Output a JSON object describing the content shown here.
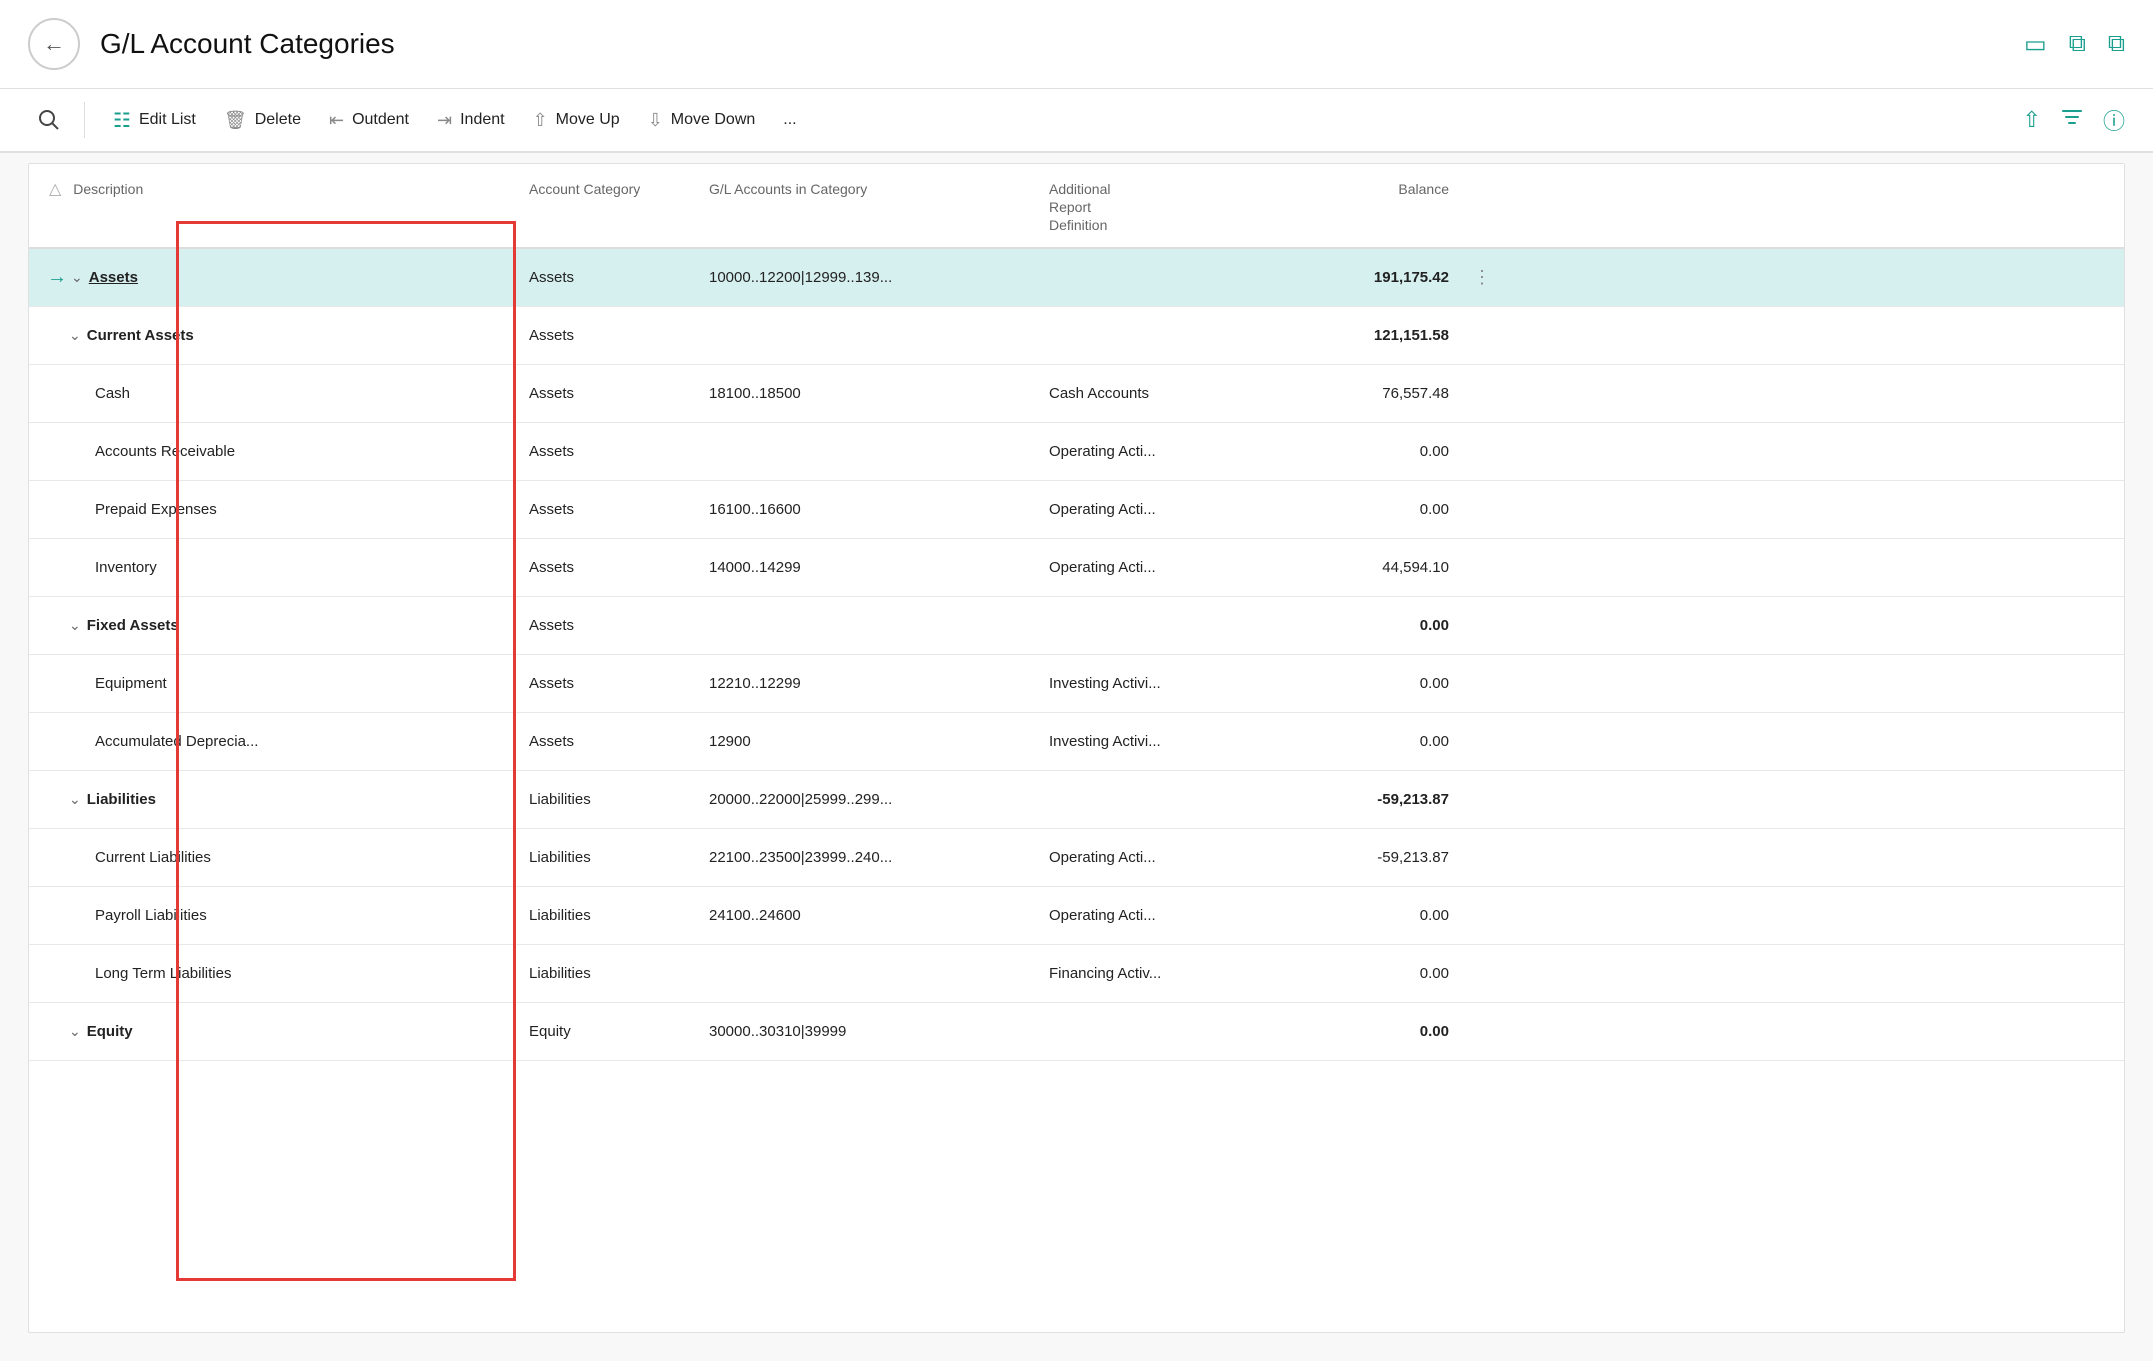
{
  "title": "G/L Account Categories",
  "toolbar": {
    "search_label": "Search",
    "edit_list_label": "Edit List",
    "delete_label": "Delete",
    "outdent_label": "Outdent",
    "indent_label": "Indent",
    "move_up_label": "Move Up",
    "move_down_label": "Move Down",
    "more_label": "..."
  },
  "columns": [
    {
      "id": "description",
      "label": "Description"
    },
    {
      "id": "account_category",
      "label": "Account Category"
    },
    {
      "id": "gl_accounts",
      "label": "G/L Accounts in Category"
    },
    {
      "id": "additional_report",
      "label": "Additional Report Definition"
    },
    {
      "id": "balance",
      "label": "Balance"
    }
  ],
  "rows": [
    {
      "id": "assets",
      "description": "Assets",
      "indent": 0,
      "bold": true,
      "underline": true,
      "chevron": "down",
      "selected": true,
      "arrow": true,
      "account_category": "Assets",
      "gl_accounts": "10000..12200|12999..139...",
      "additional_report": "",
      "balance": "191,175.42",
      "balance_bold": true,
      "dots": true
    },
    {
      "id": "current_assets",
      "description": "Current Assets",
      "indent": 1,
      "bold": true,
      "chevron": "down",
      "account_category": "Assets",
      "gl_accounts": "",
      "additional_report": "",
      "balance": "121,151.58",
      "balance_bold": true
    },
    {
      "id": "cash",
      "description": "Cash",
      "indent": 2,
      "bold": false,
      "account_category": "Assets",
      "gl_accounts": "18100..18500",
      "additional_report": "Cash Accounts",
      "balance": "76,557.48",
      "balance_bold": false
    },
    {
      "id": "accounts_receivable",
      "description": "Accounts Receivable",
      "indent": 2,
      "bold": false,
      "account_category": "Assets",
      "gl_accounts": "",
      "additional_report": "Operating Acti...",
      "balance": "0.00",
      "balance_bold": false
    },
    {
      "id": "prepaid_expenses",
      "description": "Prepaid Expenses",
      "indent": 2,
      "bold": false,
      "account_category": "Assets",
      "gl_accounts": "16100..16600",
      "additional_report": "Operating Acti...",
      "balance": "0.00",
      "balance_bold": false
    },
    {
      "id": "inventory",
      "description": "Inventory",
      "indent": 2,
      "bold": false,
      "account_category": "Assets",
      "gl_accounts": "14000..14299",
      "additional_report": "Operating Acti...",
      "balance": "44,594.10",
      "balance_bold": false
    },
    {
      "id": "fixed_assets",
      "description": "Fixed Assets",
      "indent": 1,
      "bold": true,
      "chevron": "down",
      "account_category": "Assets",
      "gl_accounts": "",
      "additional_report": "",
      "balance": "0.00",
      "balance_bold": true
    },
    {
      "id": "equipment",
      "description": "Equipment",
      "indent": 2,
      "bold": false,
      "account_category": "Assets",
      "gl_accounts": "12210..12299",
      "additional_report": "Investing Activi...",
      "balance": "0.00",
      "balance_bold": false
    },
    {
      "id": "accumulated_deprecia",
      "description": "Accumulated Deprecia...",
      "indent": 2,
      "bold": false,
      "account_category": "Assets",
      "gl_accounts": "12900",
      "additional_report": "Investing Activi...",
      "balance": "0.00",
      "balance_bold": false
    },
    {
      "id": "liabilities",
      "description": "Liabilities",
      "indent": 1,
      "bold": true,
      "chevron": "down",
      "account_category": "Liabilities",
      "gl_accounts": "20000..22000|25999..299...",
      "additional_report": "",
      "balance": "-59,213.87",
      "balance_bold": true
    },
    {
      "id": "current_liabilities",
      "description": "Current Liabilities",
      "indent": 2,
      "bold": false,
      "account_category": "Liabilities",
      "gl_accounts": "22100..23500|23999..240...",
      "additional_report": "Operating Acti...",
      "balance": "-59,213.87",
      "balance_bold": false
    },
    {
      "id": "payroll_liabilities",
      "description": "Payroll Liabilities",
      "indent": 2,
      "bold": false,
      "account_category": "Liabilities",
      "gl_accounts": "24100..24600",
      "additional_report": "Operating Acti...",
      "balance": "0.00",
      "balance_bold": false
    },
    {
      "id": "long_term_liabilities",
      "description": "Long Term Liabilities",
      "indent": 2,
      "bold": false,
      "account_category": "Liabilities",
      "gl_accounts": "",
      "additional_report": "Financing Activ...",
      "balance": "0.00",
      "balance_bold": false
    },
    {
      "id": "equity",
      "description": "Equity",
      "indent": 1,
      "bold": true,
      "chevron": "down",
      "account_category": "Equity",
      "gl_accounts": "30000..30310|39999",
      "additional_report": "",
      "balance": "0.00",
      "balance_bold": true
    }
  ]
}
